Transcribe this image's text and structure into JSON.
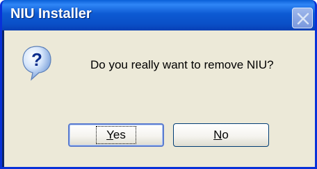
{
  "window": {
    "title": "NIU Installer",
    "close_icon": "close-x-icon"
  },
  "dialog": {
    "icon": "question-mark-icon",
    "message": "Do you really want to remove NIU?"
  },
  "buttons": {
    "yes": {
      "accel": "Y",
      "rest": "es"
    },
    "no": {
      "accel": "N",
      "rest": "o"
    }
  },
  "colors": {
    "titlebar": "#0a4fc7",
    "dialog_bg": "#ece9d8",
    "button_border": "#003c74"
  }
}
